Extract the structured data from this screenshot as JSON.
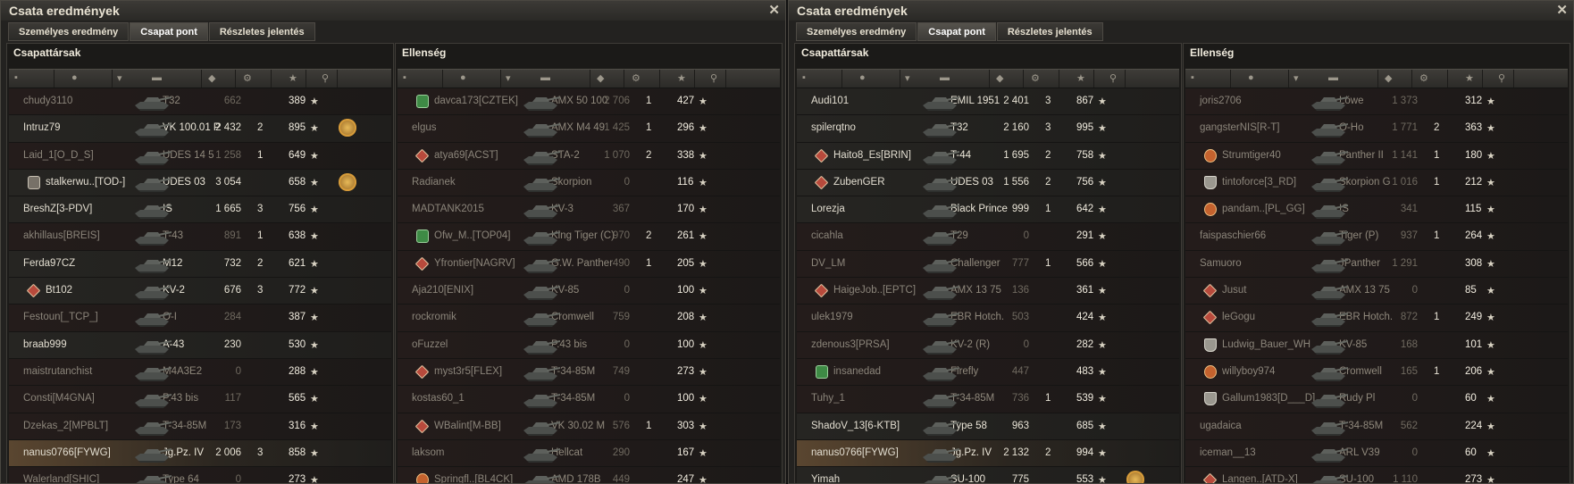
{
  "windows": [
    {
      "title": "Csata eredmények",
      "close": "✕",
      "tabs": [
        {
          "label": "Személyes eredmény",
          "active": false
        },
        {
          "label": "Csapat pont",
          "active": true
        },
        {
          "label": "Részletes jelentés",
          "active": false
        }
      ],
      "teams": [
        {
          "title": "Csapattársak",
          "players": [
            {
              "name": "chudy3110",
              "tank": "T32",
              "damage": "662",
              "kills": "",
              "xp": "389",
              "alive": false,
              "clan": "",
              "medal": false,
              "self": false
            },
            {
              "name": "Intruz79",
              "tank": "VK 100.01 P",
              "damage": "2 432",
              "kills": "2",
              "xp": "895",
              "alive": true,
              "clan": "",
              "medal": true,
              "self": false
            },
            {
              "name": "Laid_1[O_D_S]",
              "tank": "UDES 14 5",
              "damage": "1 258",
              "kills": "1",
              "xp": "649",
              "alive": false,
              "clan": "",
              "medal": false,
              "self": false
            },
            {
              "name": "stalkerwu..[TOD-]",
              "tank": "UDES 03",
              "damage": "3 054",
              "kills": "",
              "xp": "658",
              "alive": true,
              "clan": "gray",
              "medal": true,
              "self": false
            },
            {
              "name": "BreshZ[3-PDV]",
              "tank": "IS",
              "damage": "1 665",
              "kills": "3",
              "xp": "756",
              "alive": true,
              "clan": "",
              "medal": false,
              "self": false
            },
            {
              "name": "akhillaus[BREIS]",
              "tank": "T-43",
              "damage": "891",
              "kills": "1",
              "xp": "638",
              "alive": false,
              "clan": "",
              "medal": false,
              "self": false
            },
            {
              "name": "Ferda97CZ",
              "tank": "M12",
              "damage": "732",
              "kills": "2",
              "xp": "621",
              "alive": true,
              "clan": "",
              "medal": false,
              "self": false
            },
            {
              "name": "Bt102",
              "tank": "KV-2",
              "damage": "676",
              "kills": "3",
              "xp": "772",
              "alive": true,
              "clan": "diamond",
              "medal": false,
              "self": false
            },
            {
              "name": "Festoun[_TCP_]",
              "tank": "O-I",
              "damage": "284",
              "kills": "",
              "xp": "387",
              "alive": false,
              "clan": "",
              "medal": false,
              "self": false
            },
            {
              "name": "braab999",
              "tank": "A-43",
              "damage": "230",
              "kills": "",
              "xp": "530",
              "alive": true,
              "clan": "",
              "medal": false,
              "self": false
            },
            {
              "name": "maistrutanchist",
              "tank": "M4A3E2",
              "damage": "0",
              "kills": "",
              "xp": "288",
              "alive": false,
              "clan": "",
              "medal": false,
              "self": false
            },
            {
              "name": "Consti[M4GNA]",
              "tank": "P.43 bis",
              "damage": "117",
              "kills": "",
              "xp": "565",
              "alive": false,
              "clan": "",
              "medal": false,
              "self": false
            },
            {
              "name": "Dzekas_2[MPBLT]",
              "tank": "T-34-85M",
              "damage": "173",
              "kills": "",
              "xp": "316",
              "alive": false,
              "clan": "",
              "medal": false,
              "self": false
            },
            {
              "name": "nanus0766[FYWG]",
              "tank": "Jg.Pz. IV",
              "damage": "2 006",
              "kills": "3",
              "xp": "858",
              "alive": true,
              "clan": "",
              "medal": false,
              "self": true
            },
            {
              "name": "Walerland[SHIC]",
              "tank": "Type 64",
              "damage": "0",
              "kills": "",
              "xp": "273",
              "alive": false,
              "clan": "",
              "medal": false,
              "self": false
            }
          ]
        },
        {
          "title": "Ellenség",
          "players": [
            {
              "name": "davca173[CZTEK]",
              "tank": "AMX 50 100",
              "damage": "2 706",
              "kills": "1",
              "xp": "427",
              "alive": false,
              "clan": "green",
              "medal": false,
              "self": false
            },
            {
              "name": "elgus",
              "tank": "AMX M4 49",
              "damage": "1 425",
              "kills": "1",
              "xp": "296",
              "alive": false,
              "clan": "",
              "medal": false,
              "self": false
            },
            {
              "name": "atya69[ACST]",
              "tank": "STA-2",
              "damage": "1 070",
              "kills": "2",
              "xp": "338",
              "alive": false,
              "clan": "diamond",
              "medal": false,
              "self": false
            },
            {
              "name": "Radianek",
              "tank": "Skorpion",
              "damage": "0",
              "kills": "",
              "xp": "116",
              "alive": false,
              "clan": "",
              "medal": false,
              "self": false
            },
            {
              "name": "MADTANK2015",
              "tank": "KV-3",
              "damage": "367",
              "kills": "",
              "xp": "170",
              "alive": false,
              "clan": "",
              "medal": false,
              "self": false
            },
            {
              "name": "Ofw_M..[TOP04]",
              "tank": "King Tiger (C)",
              "damage": "970",
              "kills": "2",
              "xp": "261",
              "alive": false,
              "clan": "green",
              "medal": false,
              "self": false
            },
            {
              "name": "Yfrontier[NAGRV]",
              "tank": "G.W. Panther",
              "damage": "490",
              "kills": "1",
              "xp": "205",
              "alive": false,
              "clan": "diamond",
              "medal": false,
              "self": false
            },
            {
              "name": "Aja210[ENIX]",
              "tank": "KV-85",
              "damage": "0",
              "kills": "",
              "xp": "100",
              "alive": false,
              "clan": "",
              "medal": false,
              "self": false
            },
            {
              "name": "rockromik",
              "tank": "Cromwell",
              "damage": "759",
              "kills": "",
              "xp": "208",
              "alive": false,
              "clan": "",
              "medal": false,
              "self": false
            },
            {
              "name": "oFuzzel",
              "tank": "P.43 bis",
              "damage": "0",
              "kills": "",
              "xp": "100",
              "alive": false,
              "clan": "",
              "medal": false,
              "self": false
            },
            {
              "name": "myst3r5[FLEX]",
              "tank": "T-34-85M",
              "damage": "749",
              "kills": "",
              "xp": "273",
              "alive": false,
              "clan": "diamond",
              "medal": false,
              "self": false
            },
            {
              "name": "kostas60_1",
              "tank": "T-34-85M",
              "damage": "0",
              "kills": "",
              "xp": "100",
              "alive": false,
              "clan": "",
              "medal": false,
              "self": false
            },
            {
              "name": "WBalint[M-BB]",
              "tank": "VK 30.02 M",
              "damage": "576",
              "kills": "1",
              "xp": "303",
              "alive": false,
              "clan": "diamond",
              "medal": false,
              "self": false
            },
            {
              "name": "laksom",
              "tank": "Hellcat",
              "damage": "290",
              "kills": "",
              "xp": "167",
              "alive": false,
              "clan": "",
              "medal": false,
              "self": false
            },
            {
              "name": "Springfl..[BL4CK]",
              "tank": "AMD 178B",
              "damage": "449",
              "kills": "",
              "xp": "247",
              "alive": false,
              "clan": "orange",
              "medal": false,
              "self": false
            }
          ]
        }
      ]
    },
    {
      "title": "Csata eredmények",
      "close": "✕",
      "tabs": [
        {
          "label": "Személyes eredmény",
          "active": false
        },
        {
          "label": "Csapat pont",
          "active": true
        },
        {
          "label": "Részletes jelentés",
          "active": false
        }
      ],
      "teams": [
        {
          "title": "Csapattársak",
          "players": [
            {
              "name": "Audi101",
              "tank": "EMIL 1951",
              "damage": "2 401",
              "kills": "3",
              "xp": "867",
              "alive": true,
              "clan": "",
              "medal": false,
              "self": false
            },
            {
              "name": "spilerqtno",
              "tank": "T32",
              "damage": "2 160",
              "kills": "3",
              "xp": "995",
              "alive": true,
              "clan": "",
              "medal": false,
              "self": false
            },
            {
              "name": "Haito8_Es[BRIN]",
              "tank": "T-44",
              "damage": "1 695",
              "kills": "2",
              "xp": "758",
              "alive": true,
              "clan": "diamond",
              "medal": false,
              "self": false
            },
            {
              "name": "ZubenGER",
              "tank": "UDES 03",
              "damage": "1 556",
              "kills": "2",
              "xp": "756",
              "alive": true,
              "clan": "diamond",
              "medal": false,
              "self": false
            },
            {
              "name": "Lorezja",
              "tank": "Black Prince",
              "damage": "999",
              "kills": "1",
              "xp": "642",
              "alive": true,
              "clan": "",
              "medal": false,
              "self": false
            },
            {
              "name": "cicahla",
              "tank": "T29",
              "damage": "0",
              "kills": "",
              "xp": "291",
              "alive": false,
              "clan": "",
              "medal": false,
              "self": false
            },
            {
              "name": "DV_LM",
              "tank": "Challenger",
              "damage": "777",
              "kills": "1",
              "xp": "566",
              "alive": false,
              "clan": "",
              "medal": false,
              "self": false
            },
            {
              "name": "HaigeJob..[EPTC]",
              "tank": "AMX 13 75",
              "damage": "136",
              "kills": "",
              "xp": "361",
              "alive": false,
              "clan": "diamond",
              "medal": false,
              "self": false
            },
            {
              "name": "ulek1979",
              "tank": "EBR Hotch.",
              "damage": "503",
              "kills": "",
              "xp": "424",
              "alive": false,
              "clan": "",
              "medal": false,
              "self": false
            },
            {
              "name": "zdenous3[PRSA]",
              "tank": "KV-2 (R)",
              "damage": "0",
              "kills": "",
              "xp": "282",
              "alive": false,
              "clan": "",
              "medal": false,
              "self": false
            },
            {
              "name": "insanedad",
              "tank": "Firefly",
              "damage": "447",
              "kills": "",
              "xp": "483",
              "alive": false,
              "clan": "green",
              "medal": false,
              "self": false
            },
            {
              "name": "Tuhy_1",
              "tank": "T-34-85M",
              "damage": "736",
              "kills": "1",
              "xp": "539",
              "alive": false,
              "clan": "",
              "medal": false,
              "self": false
            },
            {
              "name": "ShadoV_13[6-KTB]",
              "tank": "Type 58",
              "damage": "963",
              "kills": "",
              "xp": "685",
              "alive": true,
              "clan": "",
              "medal": false,
              "self": false
            },
            {
              "name": "nanus0766[FYWG]",
              "tank": "Jg.Pz. IV",
              "damage": "2 132",
              "kills": "2",
              "xp": "994",
              "alive": true,
              "clan": "",
              "medal": false,
              "self": true
            },
            {
              "name": "Yimah",
              "tank": "SU-100",
              "damage": "775",
              "kills": "",
              "xp": "553",
              "alive": true,
              "clan": "",
              "medal": true,
              "self": false
            }
          ]
        },
        {
          "title": "Ellenség",
          "players": [
            {
              "name": "joris2706",
              "tank": "Löwe",
              "damage": "1 373",
              "kills": "",
              "xp": "312",
              "alive": false,
              "clan": "",
              "medal": false,
              "self": false
            },
            {
              "name": "gangsterNIS[R-T]",
              "tank": "O-Ho",
              "damage": "1 771",
              "kills": "2",
              "xp": "363",
              "alive": false,
              "clan": "",
              "medal": false,
              "self": false
            },
            {
              "name": "Strumtiger40",
              "tank": "Panther II",
              "damage": "1 141",
              "kills": "1",
              "xp": "180",
              "alive": false,
              "clan": "orange",
              "medal": false,
              "self": false
            },
            {
              "name": "tintoforce[3_RD]",
              "tank": "Skorpion G",
              "damage": "1 016",
              "kills": "1",
              "xp": "212",
              "alive": false,
              "clan": "shield",
              "medal": false,
              "self": false
            },
            {
              "name": "pandam..[PL_GG]",
              "tank": "IS",
              "damage": "341",
              "kills": "",
              "xp": "115",
              "alive": false,
              "clan": "orange",
              "medal": false,
              "self": false
            },
            {
              "name": "faispaschier66",
              "tank": "Tiger (P)",
              "damage": "937",
              "kills": "1",
              "xp": "264",
              "alive": false,
              "clan": "",
              "medal": false,
              "self": false
            },
            {
              "name": "Samuoro",
              "tank": "JPanther",
              "damage": "1 291",
              "kills": "",
              "xp": "308",
              "alive": false,
              "clan": "",
              "medal": false,
              "self": false
            },
            {
              "name": "Jusut",
              "tank": "AMX 13 75",
              "damage": "0",
              "kills": "",
              "xp": "85",
              "alive": false,
              "clan": "diamond",
              "medal": false,
              "self": false
            },
            {
              "name": "leGogu",
              "tank": "EBR Hotch.",
              "damage": "872",
              "kills": "1",
              "xp": "249",
              "alive": false,
              "clan": "diamond",
              "medal": false,
              "self": false
            },
            {
              "name": "Ludwig_Bauer_WH",
              "tank": "KV-85",
              "damage": "168",
              "kills": "",
              "xp": "101",
              "alive": false,
              "clan": "shield",
              "medal": false,
              "self": false
            },
            {
              "name": "willyboy974",
              "tank": "Cromwell",
              "damage": "165",
              "kills": "1",
              "xp": "206",
              "alive": false,
              "clan": "orange",
              "medal": false,
              "self": false
            },
            {
              "name": "Gallum1983[D___D]",
              "tank": "Rudy Pl",
              "damage": "0",
              "kills": "",
              "xp": "60",
              "alive": false,
              "clan": "shield",
              "medal": false,
              "self": false
            },
            {
              "name": "ugadaica",
              "tank": "T-34-85M",
              "damage": "562",
              "kills": "",
              "xp": "224",
              "alive": false,
              "clan": "",
              "medal": false,
              "self": false
            },
            {
              "name": "iceman__13",
              "tank": "ARL V39",
              "damage": "0",
              "kills": "",
              "xp": "60",
              "alive": false,
              "clan": "",
              "medal": false,
              "self": false
            },
            {
              "name": "Langen..[ATD-X]",
              "tank": "SU-100",
              "damage": "1 110",
              "kills": "",
              "xp": "273",
              "alive": false,
              "clan": "diamond",
              "medal": false,
              "self": false
            }
          ]
        }
      ]
    }
  ],
  "icons": {
    "star": "★",
    "column_icons": [
      "platoon-icon",
      "player-icon",
      "sort-arrow-icon",
      "tank-icon",
      "damage-icon",
      "kills-icon",
      "xp-star-icon",
      "medal-icon"
    ]
  },
  "colors": {
    "alive_text": "#e2ddd0",
    "dead_text": "#8b857a",
    "self_row": "#5a4630",
    "background": "#1b1a18"
  }
}
